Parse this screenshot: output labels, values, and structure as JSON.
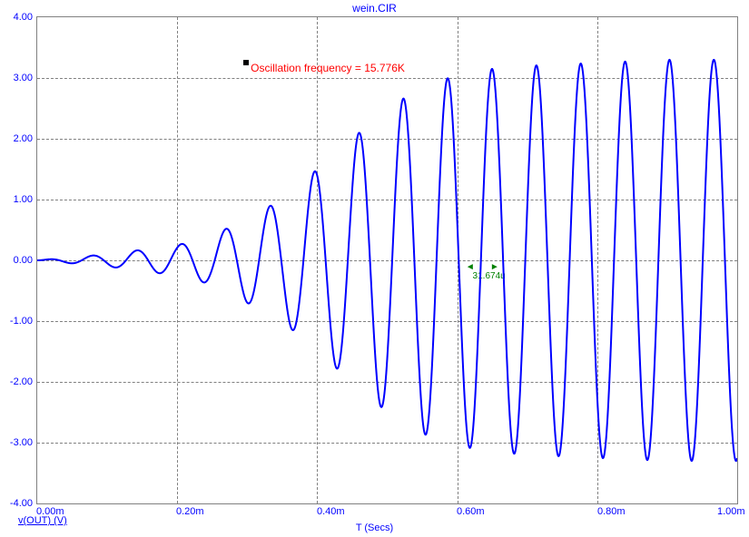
{
  "title": "wein.CIR",
  "legend": "v(OUT) (V)",
  "xlabel": "T (Secs)",
  "annotation": {
    "text": "Oscillation frequency = 15.776K"
  },
  "measurement": {
    "label": "31.674u",
    "left_arrow": "◄",
    "right_arrow": "►"
  },
  "yticks": {
    "y0": "-4.00",
    "y1": "-3.00",
    "y2": "-2.00",
    "y3": "-1.00",
    "y4": "0.00",
    "y5": "1.00",
    "y6": "2.00",
    "y7": "3.00",
    "y8": "4.00"
  },
  "xticks": {
    "x0": "0.00m",
    "x1": "0.20m",
    "x2": "0.40m",
    "x3": "0.60m",
    "x4": "0.80m",
    "x5": "1.00m"
  },
  "chart_data": {
    "type": "line",
    "title": "wein.CIR",
    "xlabel": "T (Secs)",
    "ylabel": "v(OUT) (V)",
    "xlim": [
      0.0,
      0.001
    ],
    "ylim": [
      -4.0,
      4.0
    ],
    "annotations": [
      {
        "text": "Oscillation frequency = 15.776K",
        "color": "#ff0000"
      },
      {
        "text": "31.674u",
        "color": "#008000",
        "meaning": "period marker between two adjacent zero-crossings"
      }
    ],
    "grid": true,
    "series": [
      {
        "name": "v(OUT)",
        "color": "#0000ff",
        "description": "Growing sinusoidal oscillation at ~15.776 kHz that starts near 0V and grows until it saturates at roughly ±3.3V",
        "frequency_hz": 15776,
        "period_s": 3.1674e-05,
        "envelope_peaks_V": [
          {
            "t": 0.0,
            "v": 0.0
          },
          {
            "t": 0.0001,
            "v": 0.1
          },
          {
            "t": 0.0002,
            "v": 0.25
          },
          {
            "t": 0.00025,
            "v": 0.4
          },
          {
            "t": 0.0003,
            "v": 0.7
          },
          {
            "t": 0.00035,
            "v": 1.0
          },
          {
            "t": 0.0004,
            "v": 1.5
          },
          {
            "t": 0.00045,
            "v": 2.0
          },
          {
            "t": 0.0005,
            "v": 2.5
          },
          {
            "t": 0.00055,
            "v": 2.85
          },
          {
            "t": 0.0006,
            "v": 3.05
          },
          {
            "t": 0.00065,
            "v": 3.15
          },
          {
            "t": 0.0007,
            "v": 3.2
          },
          {
            "t": 0.0008,
            "v": 3.25
          },
          {
            "t": 0.0009,
            "v": 3.3
          },
          {
            "t": 0.001,
            "v": 3.3
          }
        ]
      }
    ]
  }
}
